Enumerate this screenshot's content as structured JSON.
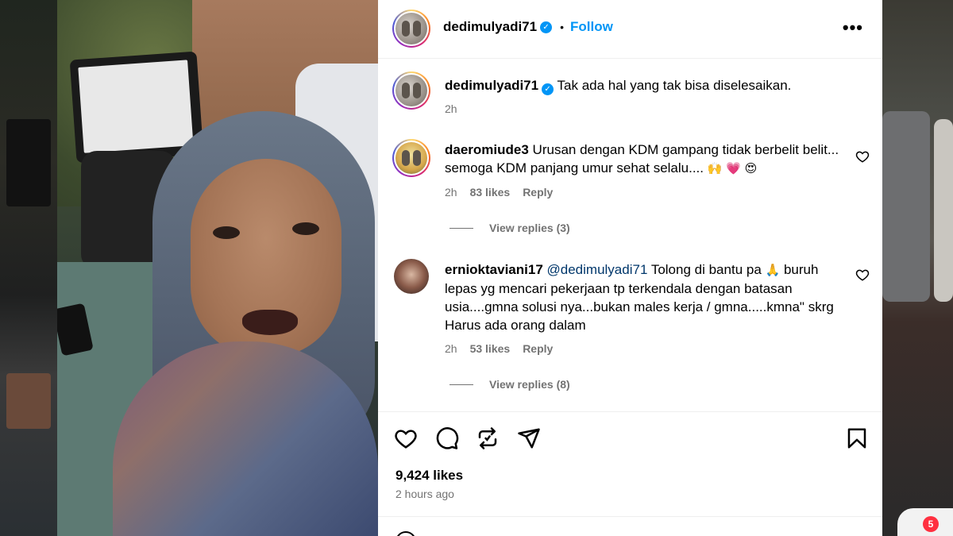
{
  "post": {
    "username": "dedimulyadi71",
    "follow_label": "Follow",
    "more_label": "•••",
    "caption": "Tak ada hal yang tak bisa diselesaikan.",
    "caption_time": "2h"
  },
  "comments": [
    {
      "username": "daeromiude3",
      "text": "Urusan dengan KDM gampang tidak berbelit belit... semoga KDM panjang umur sehat selalu....",
      "emojis": "🙌 💗 😍",
      "time": "2h",
      "likes": "83 likes",
      "reply_label": "Reply",
      "view_replies": "View replies (3)"
    },
    {
      "username": "ernioktaviani17",
      "mention": "@dedimulyadi71",
      "text_part1": "Tolong di bantu pa",
      "emoji": "🙏",
      "text_part2": "buruh lepas yg mencari pekerjaan tp terkendala dengan batasan usia....gmna solusi nya...bukan males kerja / gmna.....kmna\" skrg Harus ada orang dalam",
      "time": "2h",
      "likes": "53 likes",
      "reply_label": "Reply",
      "view_replies": "View replies (8)"
    }
  ],
  "footer": {
    "likes": "9,424 likes",
    "time": "2 hours ago"
  },
  "notification": {
    "count": "5"
  },
  "colors": {
    "accent": "#0095f6",
    "muted": "#737373",
    "mention": "#00376b",
    "badge": "#ff3040"
  }
}
